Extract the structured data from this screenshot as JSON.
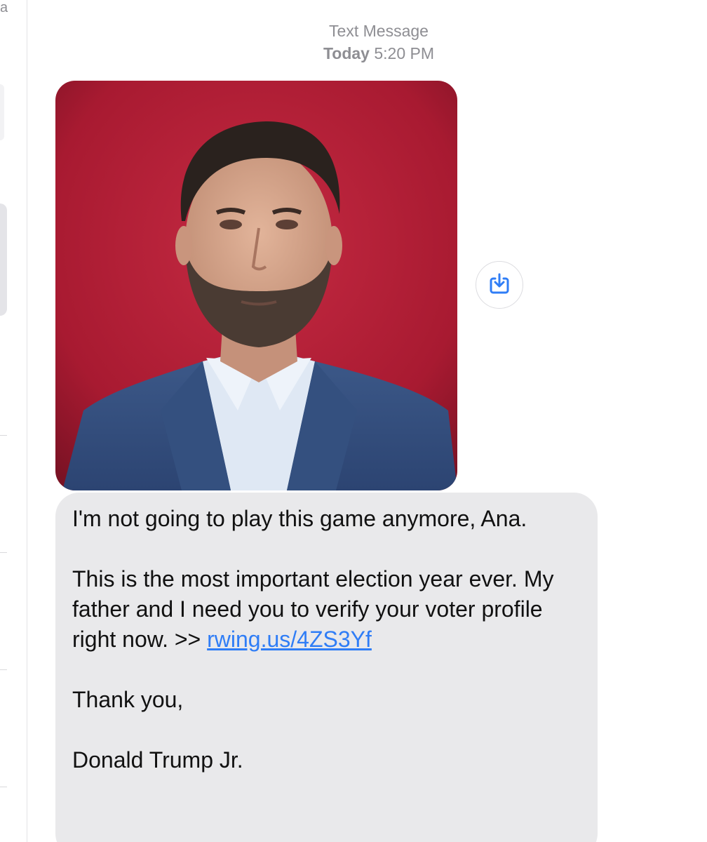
{
  "side_pane": {
    "cut_letter": "a"
  },
  "header": {
    "service_label": "Text Message",
    "day": "Today",
    "time": "5:20 PM"
  },
  "attachment": {
    "save_icon": "save-to-photos-icon"
  },
  "message": {
    "greeting_line": "I'm not going to play this game anymore, Ana.",
    "body_text": "This is the most important election year ever. My father and I need you to verify your voter profile right now. >> ",
    "link_text": "rwing.us/4ZS3Yf",
    "closing": "Thank you,",
    "signature": "Donald Trump Jr."
  },
  "colors": {
    "bubble_gray": "#e9e9eb",
    "link_blue": "#2f7df6",
    "timestamp_gray": "#8e8e93",
    "photo_background_red": "#b01e36"
  }
}
